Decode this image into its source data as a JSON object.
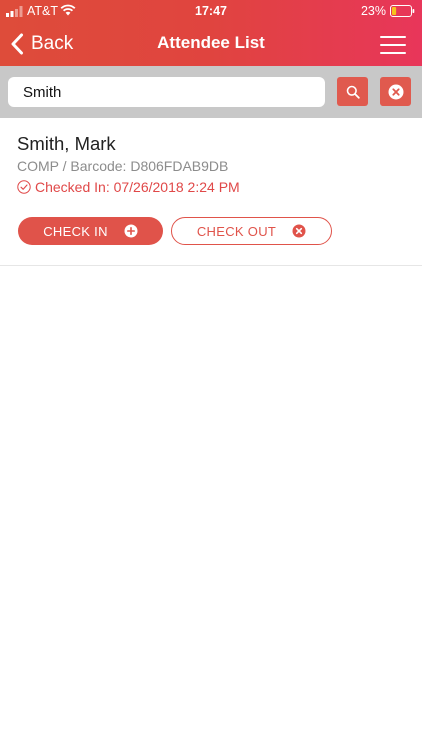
{
  "status_bar": {
    "carrier": "AT&T",
    "time": "17:47",
    "battery": "23%",
    "battery_level": 0.23
  },
  "nav": {
    "back_label": "Back",
    "title": "Attendee List"
  },
  "search": {
    "value": "Smith"
  },
  "attendee": {
    "name": "Smith, Mark",
    "barcode_line": "COMP / Barcode: D806FDAB9DB",
    "status": "Checked In: 07/26/2018 2:24 PM",
    "check_in_label": "CHECK IN",
    "check_out_label": "CHECK OUT"
  },
  "colors": {
    "header_start": "#de4c3a",
    "header_end": "#e8365a",
    "accent": "#e0534a",
    "search_bar_bg": "#c8c8c8",
    "battery_fill": "#f6c21d"
  },
  "icons": [
    "signal-icon",
    "wifi-icon",
    "battery-icon",
    "back-chevron-icon",
    "menu-icon",
    "search-icon",
    "clear-icon",
    "check-circle-icon",
    "plus-circle-icon",
    "x-circle-icon"
  ]
}
